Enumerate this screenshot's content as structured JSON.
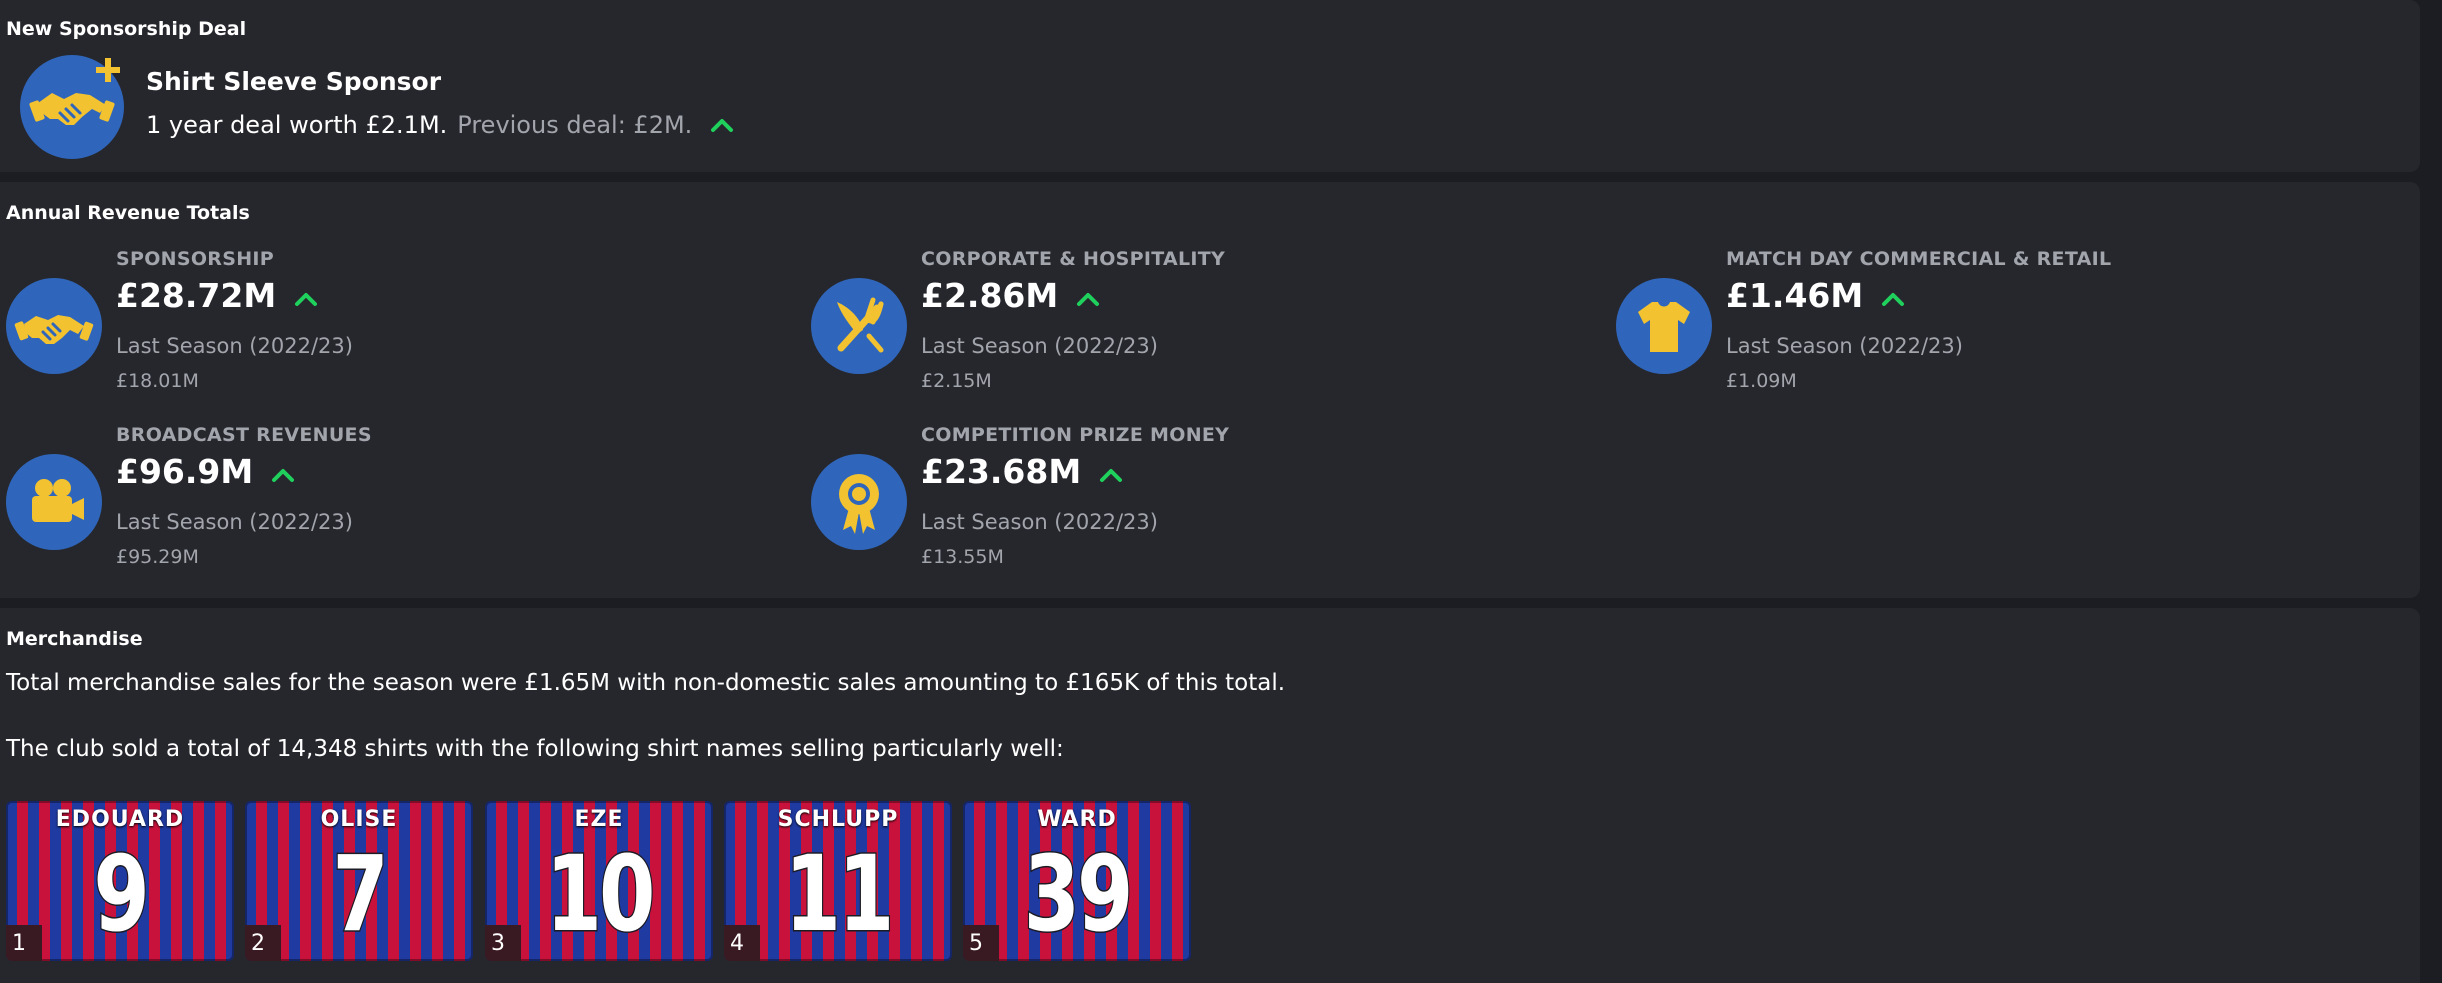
{
  "sponsorship_deal": {
    "panel_title": "New Sponsorship Deal",
    "deal_title": "Shirt Sleeve Sponsor",
    "deal_text": "1 year deal worth £2.1M.",
    "previous_text": "Previous deal: £2M.",
    "icon": "handshake-plus-icon"
  },
  "revenue": {
    "panel_title": "Annual Revenue Totals",
    "items": [
      {
        "label": "SPONSORSHIP",
        "value": "£28.72M",
        "last_label": "Last Season (2022/23)",
        "last_value": "£18.01M",
        "icon": "handshake-icon",
        "trend": "up"
      },
      {
        "label": "CORPORATE & HOSPITALITY",
        "value": "£2.86M",
        "last_label": "Last Season (2022/23)",
        "last_value": "£2.15M",
        "icon": "cutlery-icon",
        "trend": "up"
      },
      {
        "label": "MATCH DAY COMMERCIAL & RETAIL",
        "value": "£1.46M",
        "last_label": "Last Season (2022/23)",
        "last_value": "£1.09M",
        "icon": "shirt-icon",
        "trend": "up"
      },
      {
        "label": "BROADCAST REVENUES",
        "value": "£96.9M",
        "last_label": "Last Season (2022/23)",
        "last_value": "£95.29M",
        "icon": "camera-icon",
        "trend": "up"
      },
      {
        "label": "COMPETITION PRIZE MONEY",
        "value": "£23.68M",
        "last_label": "Last Season (2022/23)",
        "last_value": "£13.55M",
        "icon": "rosette-icon",
        "trend": "up"
      }
    ]
  },
  "merchandise": {
    "panel_title": "Merchandise",
    "summary": "Total merchandise sales for the season were £1.65M with non-domestic sales amounting to £165K of this total.",
    "shirts_text": "The club sold a total of 14,348 shirts with the following shirt names selling particularly well:",
    "shirts": [
      {
        "rank": "1",
        "name": "EDOUARD",
        "number": "9"
      },
      {
        "rank": "2",
        "name": "OLISE",
        "number": "7"
      },
      {
        "rank": "3",
        "name": "EZE",
        "number": "10"
      },
      {
        "rank": "4",
        "name": "SCHLUPP",
        "number": "11"
      },
      {
        "rank": "5",
        "name": "WARD",
        "number": "39"
      }
    ]
  },
  "colors": {
    "background": "#1c1d22",
    "panel": "#26272d",
    "icon_circle": "#2f66bb",
    "icon_fill": "#f2c230",
    "trend_up": "#1fd15c",
    "muted_text": "#a3a5ad",
    "shirt_blue": "#1f3aa0",
    "shirt_red": "#c8123c"
  }
}
